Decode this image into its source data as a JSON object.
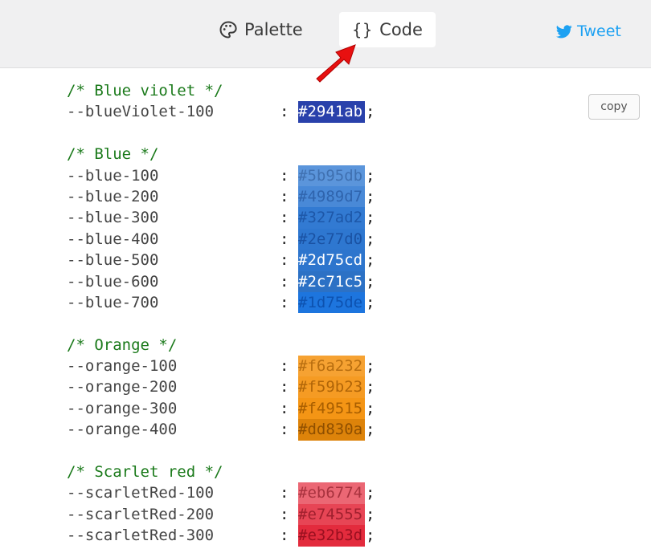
{
  "header": {
    "tabs": [
      {
        "label": "Palette",
        "icon": "palette-icon"
      },
      {
        "label": "Code",
        "icon": "code-braces-icon",
        "active": true
      }
    ],
    "tweet_label": "Tweet",
    "tweet_color": "#1da1f2"
  },
  "copy_label": "copy",
  "groups": [
    {
      "comment": "/* Blue violet */",
      "vars": [
        {
          "name": "--blueViolet-100",
          "hex": "#2941ab",
          "text_color": "#ffffff"
        }
      ]
    },
    {
      "comment": "/* Blue */",
      "vars": [
        {
          "name": "--blue-100",
          "hex": "#5b95db",
          "text_color": "#3f70b0"
        },
        {
          "name": "--blue-200",
          "hex": "#4989d7",
          "text_color": "#2f64ad"
        },
        {
          "name": "--blue-300",
          "hex": "#327ad2",
          "text_color": "#1d57a8"
        },
        {
          "name": "--blue-400",
          "hex": "#2e77d0",
          "text_color": "#1a52a3"
        },
        {
          "name": "--blue-500",
          "hex": "#2d75cd",
          "text_color": "#ffffff"
        },
        {
          "name": "--blue-600",
          "hex": "#2c71c5",
          "text_color": "#ffffff"
        },
        {
          "name": "--blue-700",
          "hex": "#1d75de",
          "text_color": "#0d52b0"
        }
      ]
    },
    {
      "comment": "/* Orange */",
      "vars": [
        {
          "name": "--orange-100",
          "hex": "#f6a232",
          "text_color": "#b86e10"
        },
        {
          "name": "--orange-200",
          "hex": "#f59b23",
          "text_color": "#b06508"
        },
        {
          "name": "--orange-300",
          "hex": "#f49515",
          "text_color": "#a85e00"
        },
        {
          "name": "--orange-400",
          "hex": "#dd830a",
          "text_color": "#8f4f00"
        }
      ]
    },
    {
      "comment": "/* Scarlet red */",
      "vars": [
        {
          "name": "--scarletRed-100",
          "hex": "#eb6774",
          "text_color": "#a8323e"
        },
        {
          "name": "--scarletRed-200",
          "hex": "#e74555",
          "text_color": "#a0202e"
        },
        {
          "name": "--scarletRed-300",
          "hex": "#e32b3d",
          "text_color": "#9a1020"
        }
      ]
    }
  ]
}
